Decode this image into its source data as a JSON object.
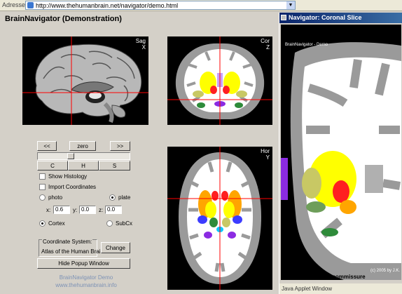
{
  "address_bar": {
    "label": "Adresse",
    "url": "http://www.thehumanbrain.net/navigator/demo.html"
  },
  "app": {
    "title": "BrainNavigator (Demonstration)"
  },
  "views": {
    "sagittal": {
      "name": "Sag",
      "axis": "X"
    },
    "coronal": {
      "name": "Cor",
      "axis": "Z"
    },
    "horizontal": {
      "name": "Hor",
      "axis": "Y"
    }
  },
  "controls": {
    "prev_label": "<<",
    "zero_label": "zero",
    "next_label": ">>",
    "view_c": "C",
    "view_h": "H",
    "view_s": "S",
    "show_histology": "Show Histology",
    "import_coordinates": "Import Coordinates",
    "photo_label": "photo",
    "plate_label": "plate",
    "x_label": "x:",
    "y_label": "y:",
    "z_label": "z:",
    "x_value": "0.6",
    "y_value": "0.0",
    "z_value": "0.0",
    "cortex_label": "Cortex",
    "subcx_label": "SubCx",
    "coord_system_label": "Coordinate System:",
    "coord_system_value": "Atlas of the Human Brain",
    "change_label": "Change",
    "hide_popup_label": "Hide Popup Window"
  },
  "footer": {
    "line1": "BrainNavigator Demo",
    "line2": "www.thehumanbrain.info"
  },
  "popup": {
    "title": "Navigator: Coronal Slice",
    "watermark": "BrainNavigator - Demo",
    "copyright": "(c) 2005 by J.K.",
    "structure_label": "Structure: anterior commissure",
    "applet_text": "Java Applet Window"
  },
  "colors": {
    "crosshair": "#ff0000",
    "gray_matter": "#9a9a9a",
    "white_matter": "#ffffff",
    "thalamus_yellow": "#ffff00",
    "putamen_orange": "#ffa500",
    "caudate_olive": "#c8c864",
    "hippocampus_green": "#2e8b3a",
    "ventricle_purple": "#8b2be2"
  }
}
